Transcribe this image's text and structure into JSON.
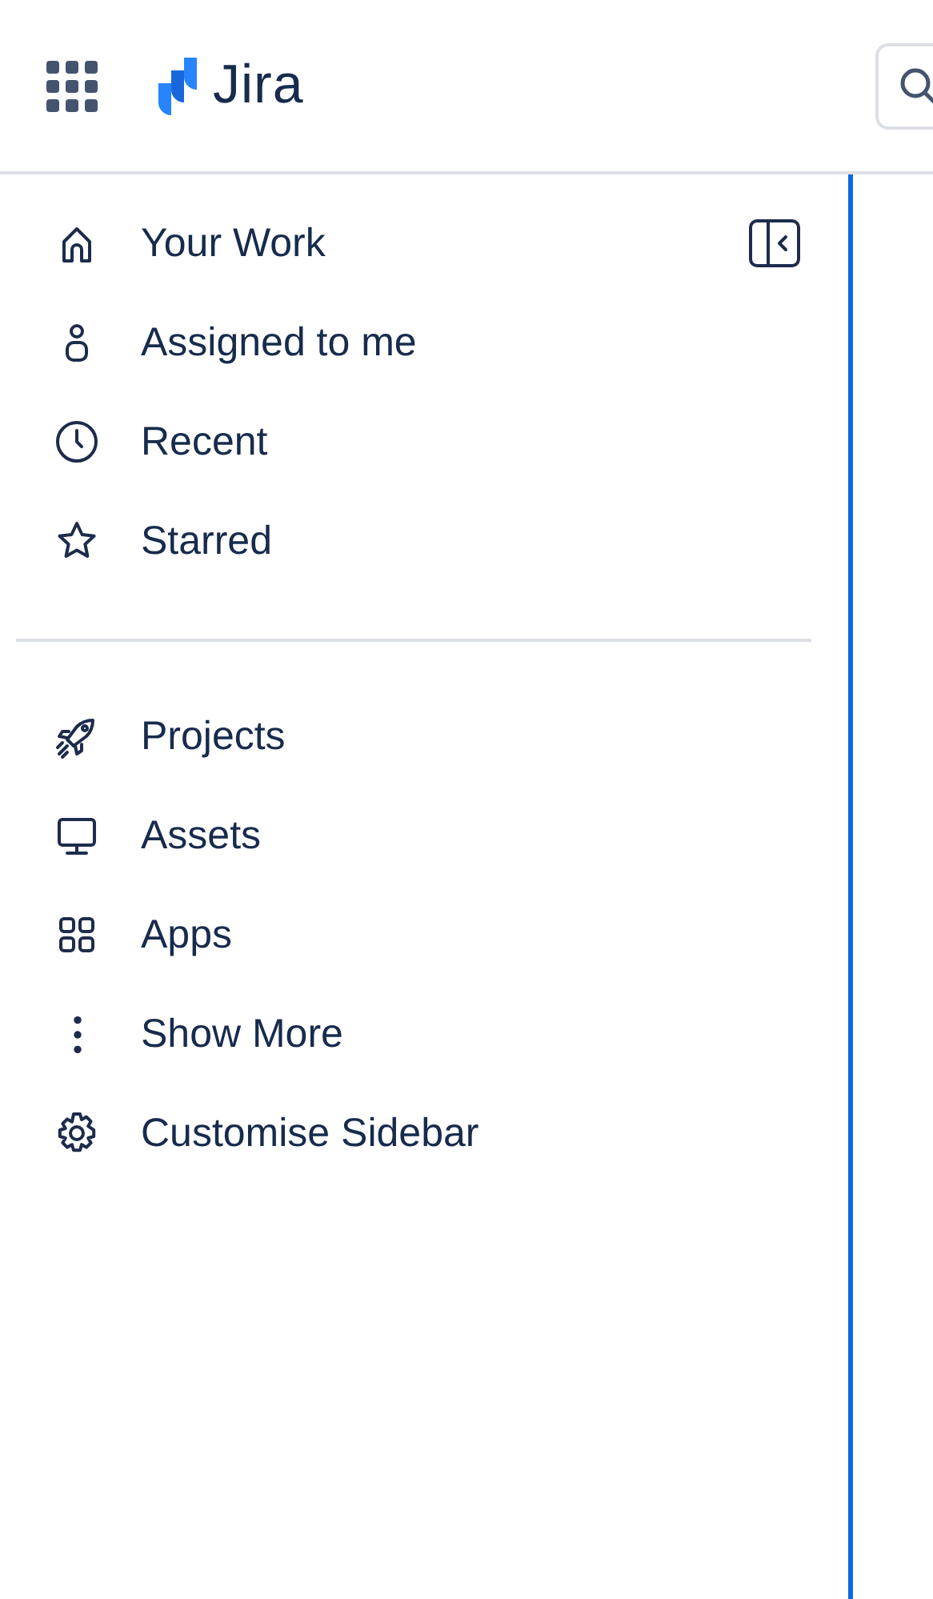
{
  "header": {
    "product_name": "Jira"
  },
  "sidebar": {
    "groups": [
      {
        "items": [
          {
            "label": "Your Work"
          },
          {
            "label": "Assigned to me"
          },
          {
            "label": "Recent"
          },
          {
            "label": "Starred"
          }
        ]
      },
      {
        "items": [
          {
            "label": "Projects"
          },
          {
            "label": "Assets"
          },
          {
            "label": "Apps"
          },
          {
            "label": "Show More"
          },
          {
            "label": "Customise Sidebar"
          }
        ]
      }
    ]
  }
}
